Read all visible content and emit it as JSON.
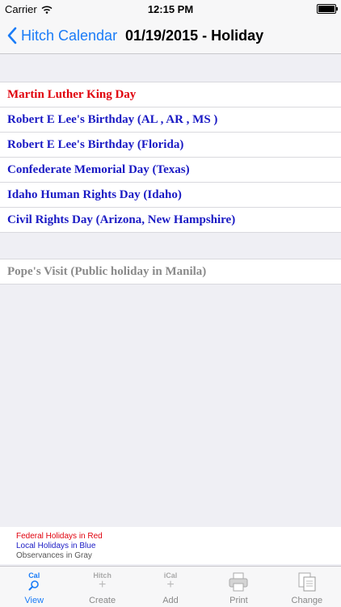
{
  "status": {
    "carrier": "Carrier",
    "time": "12:15 PM"
  },
  "nav": {
    "back_label": "Hitch Calendar",
    "title": "01/19/2015 - Holiday"
  },
  "holidays": [
    {
      "name": "Martin Luther King Day",
      "kind": "federal"
    },
    {
      "name": "Robert E Lee's Birthday (AL , AR , MS )",
      "kind": "local"
    },
    {
      "name": "Robert E Lee's Birthday (Florida)",
      "kind": "local"
    },
    {
      "name": "Confederate Memorial Day (Texas)",
      "kind": "local"
    },
    {
      "name": "Idaho Human Rights Day (Idaho)",
      "kind": "local"
    },
    {
      "name": "Civil Rights Day (Arizona, New Hampshire)",
      "kind": "local"
    }
  ],
  "observances": [
    {
      "name": "Pope's Visit (Public holiday in Manila)",
      "kind": "observance"
    }
  ],
  "legend": {
    "federal": "Federal Holidays in Red",
    "local": "Local Holidays in Blue",
    "observance": "Observances in Gray"
  },
  "colors": {
    "federal": "#e0000c",
    "local": "#1a1ac4",
    "observance": "#8a8a8a",
    "accent": "#1a7cf7"
  },
  "tabs": [
    {
      "label": "View",
      "icon_text": "Cal",
      "icon": "magnifier-icon",
      "active": true
    },
    {
      "label": "Create",
      "icon_text": "Hitch",
      "icon": "plus-icon",
      "active": false
    },
    {
      "label": "Add",
      "icon_text": "iCal",
      "icon": "plus-icon",
      "active": false
    },
    {
      "label": "Print",
      "icon_text": "",
      "icon": "printer-icon",
      "active": false
    },
    {
      "label": "Change",
      "icon_text": "",
      "icon": "copy-pages-icon",
      "active": false
    }
  ]
}
